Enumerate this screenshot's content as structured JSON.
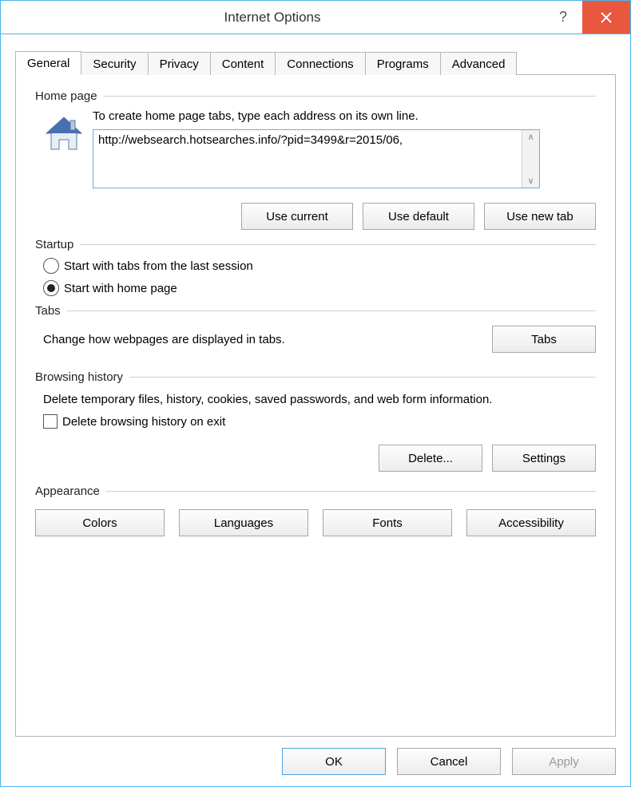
{
  "title": "Internet Options",
  "tabs": [
    "General",
    "Security",
    "Privacy",
    "Content",
    "Connections",
    "Programs",
    "Advanced"
  ],
  "active_tab": 0,
  "homepage": {
    "group_label": "Home page",
    "instruction": "To create home page tabs, type each address on its own line.",
    "url_value": "http://websearch.hotsearches.info/?pid=3499&r=2015/06,",
    "buttons": {
      "use_current": "Use current",
      "use_default": "Use default",
      "use_new_tab": "Use new tab"
    }
  },
  "startup": {
    "group_label": "Startup",
    "option_last_session": "Start with tabs from the last session",
    "option_home_page": "Start with home page",
    "selected": "home_page"
  },
  "tabs_section": {
    "group_label": "Tabs",
    "text": "Change how webpages are displayed in tabs.",
    "button": "Tabs"
  },
  "history": {
    "group_label": "Browsing history",
    "text": "Delete temporary files, history, cookies, saved passwords, and web form information.",
    "checkbox_label": "Delete browsing history on exit",
    "checkbox_checked": false,
    "delete_button": "Delete...",
    "settings_button": "Settings"
  },
  "appearance": {
    "group_label": "Appearance",
    "colors": "Colors",
    "languages": "Languages",
    "fonts": "Fonts",
    "accessibility": "Accessibility"
  },
  "footer": {
    "ok": "OK",
    "cancel": "Cancel",
    "apply": "Apply"
  }
}
